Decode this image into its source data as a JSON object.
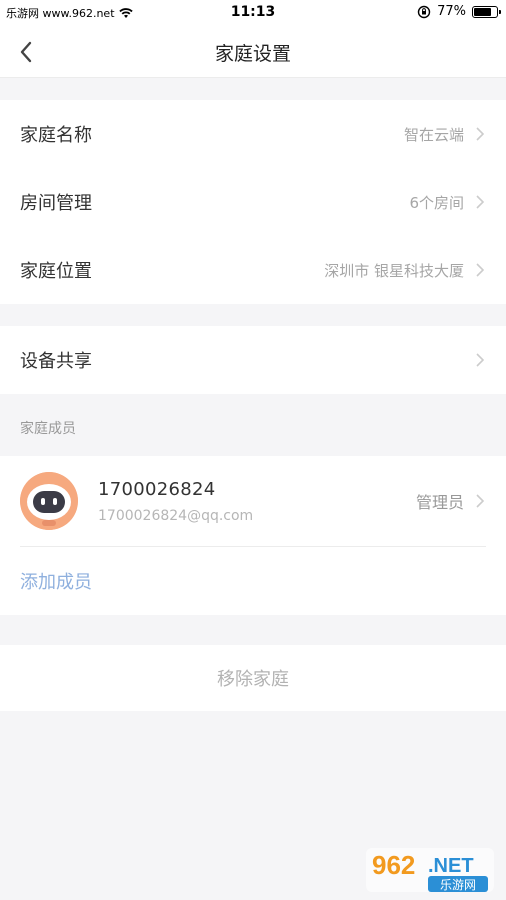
{
  "status_bar": {
    "carrier": "乐游网 www.962.net",
    "time": "11:13",
    "battery": "77%",
    "battery_level": 0.77
  },
  "nav": {
    "title": "家庭设置",
    "back_icon": "chevron-left-icon"
  },
  "home_section": {
    "rows": [
      {
        "label": "家庭名称",
        "value": "智在云端"
      },
      {
        "label": "房间管理",
        "value": "6个房间"
      },
      {
        "label": "家庭位置",
        "value": "深圳市 银星科技大厦"
      }
    ]
  },
  "share_section": {
    "label": "设备共享"
  },
  "members_section": {
    "header": "家庭成员",
    "members": [
      {
        "name": "1700026824",
        "email": "1700026824@qq.com",
        "role": "管理员"
      }
    ],
    "add_label": "添加成员"
  },
  "remove_label": "移除家庭",
  "watermark": {
    "number": "962",
    "suffix": ".NET",
    "text": "乐游网"
  },
  "colors": {
    "background": "#f5f5f7",
    "link": "#8fb0de",
    "secondary_text": "#a6a6a6",
    "avatar": "#f6a97f"
  }
}
